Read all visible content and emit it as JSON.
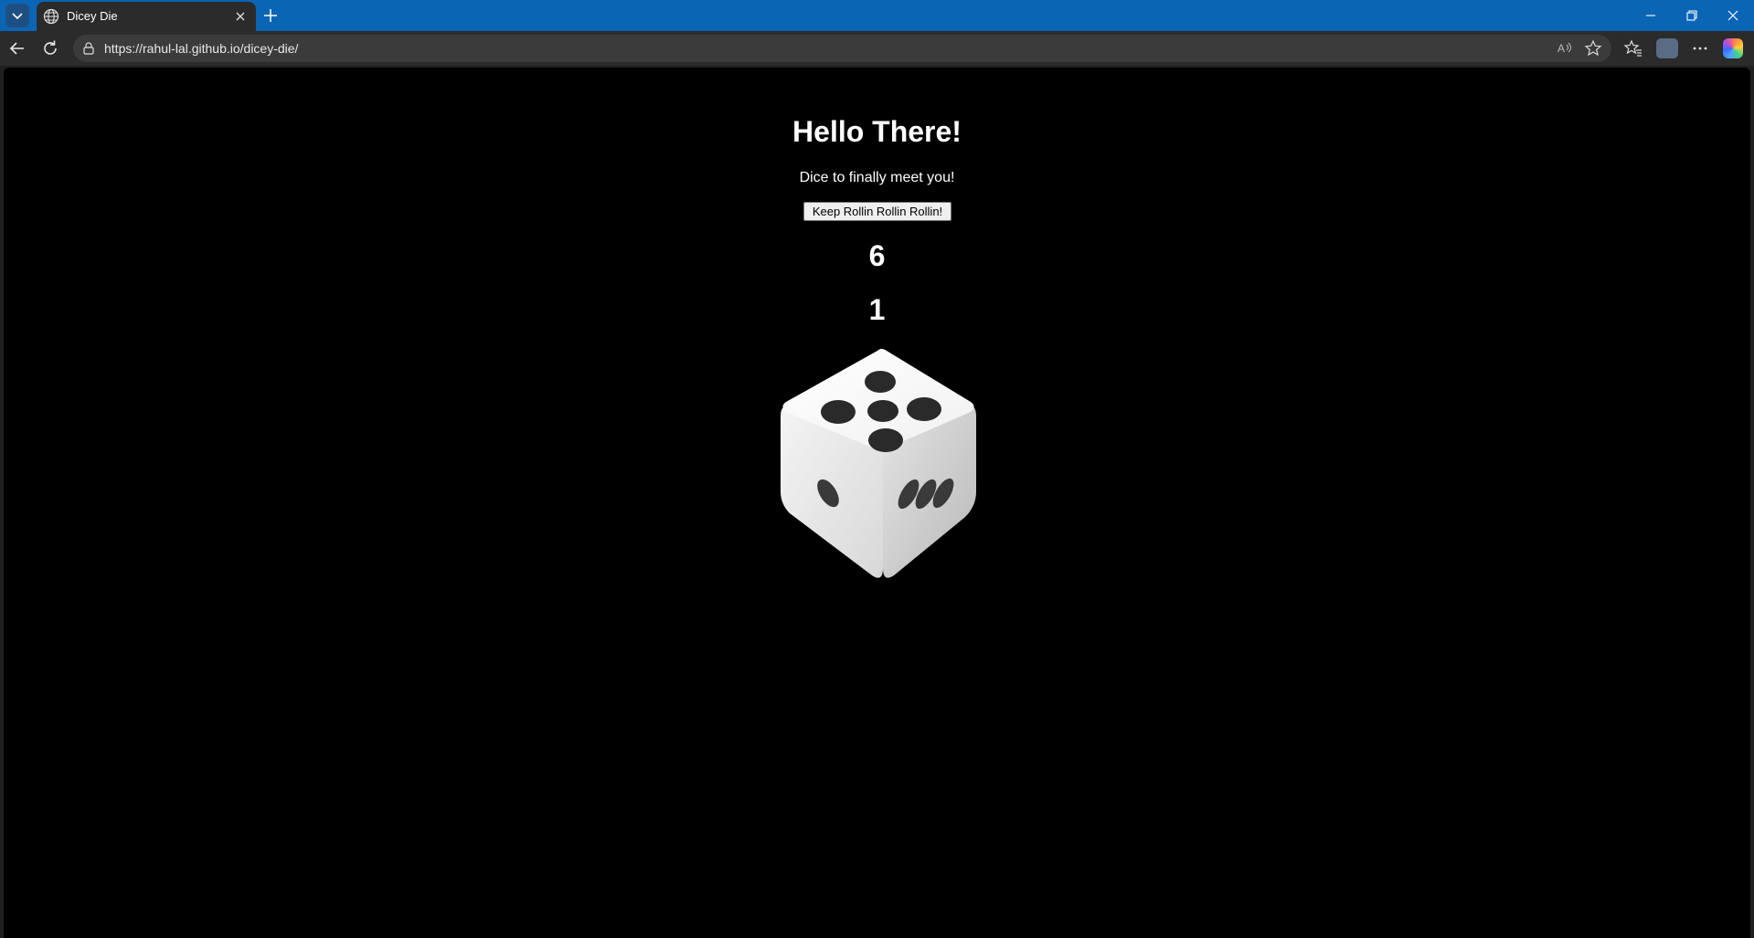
{
  "browser": {
    "tab": {
      "title": "Dicey Die",
      "favicon": "globe-icon"
    },
    "address_bar": {
      "url": "https://rahul-lal.github.io/dicey-die/"
    },
    "accent": "#0a65b5"
  },
  "page": {
    "heading": "Hello There!",
    "subtext": "Dice to finally meet you!",
    "button_label": "Keep Rollin Rollin Rollin!",
    "result_1": "6",
    "result_2": "1",
    "dice": {
      "top_face_pips": 5,
      "left_face_pips": 1,
      "right_face_pips": 3
    },
    "background": "#000000",
    "text_color": "#ffffff"
  }
}
